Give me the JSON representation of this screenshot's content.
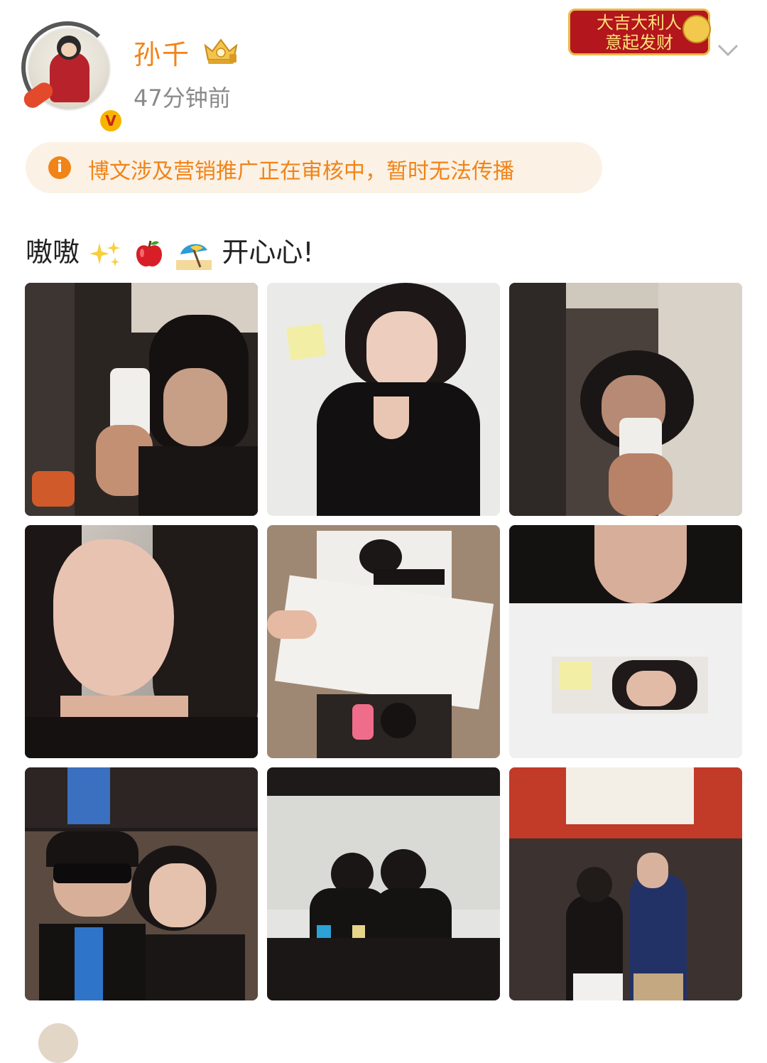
{
  "post": {
    "author": {
      "name": "孙千",
      "verified": true,
      "vip_icon": "crown-icon"
    },
    "timestamp": "47分钟前",
    "festival_badge": {
      "line1": "大吉大利人",
      "line2": "意起发财"
    },
    "notice": {
      "icon": "info-icon",
      "text": "博文涉及营销推广正在审核中，暂时无法传播"
    },
    "text": {
      "before": "嗷嗷",
      "after": "开心心!"
    },
    "emojis": [
      "sparkles-icon",
      "red-apple-icon",
      "beach-umbrella-icon"
    ],
    "photos": [
      {
        "name": "photo-mirror-selfie-1"
      },
      {
        "name": "photo-selfie-black-cardigan"
      },
      {
        "name": "photo-mirror-selfie-2"
      },
      {
        "name": "photo-closeup-face"
      },
      {
        "name": "photo-collage-celine-sketch"
      },
      {
        "name": "photo-collage-hand-chin"
      },
      {
        "name": "photo-peace-sign-duo"
      },
      {
        "name": "photo-table-duo"
      },
      {
        "name": "photo-mirror-duo"
      }
    ]
  },
  "colors": {
    "accent": "#f08418",
    "notice_bg": "#fbf1e5",
    "text": "#222222",
    "secondary_text": "#8a8a8a"
  }
}
